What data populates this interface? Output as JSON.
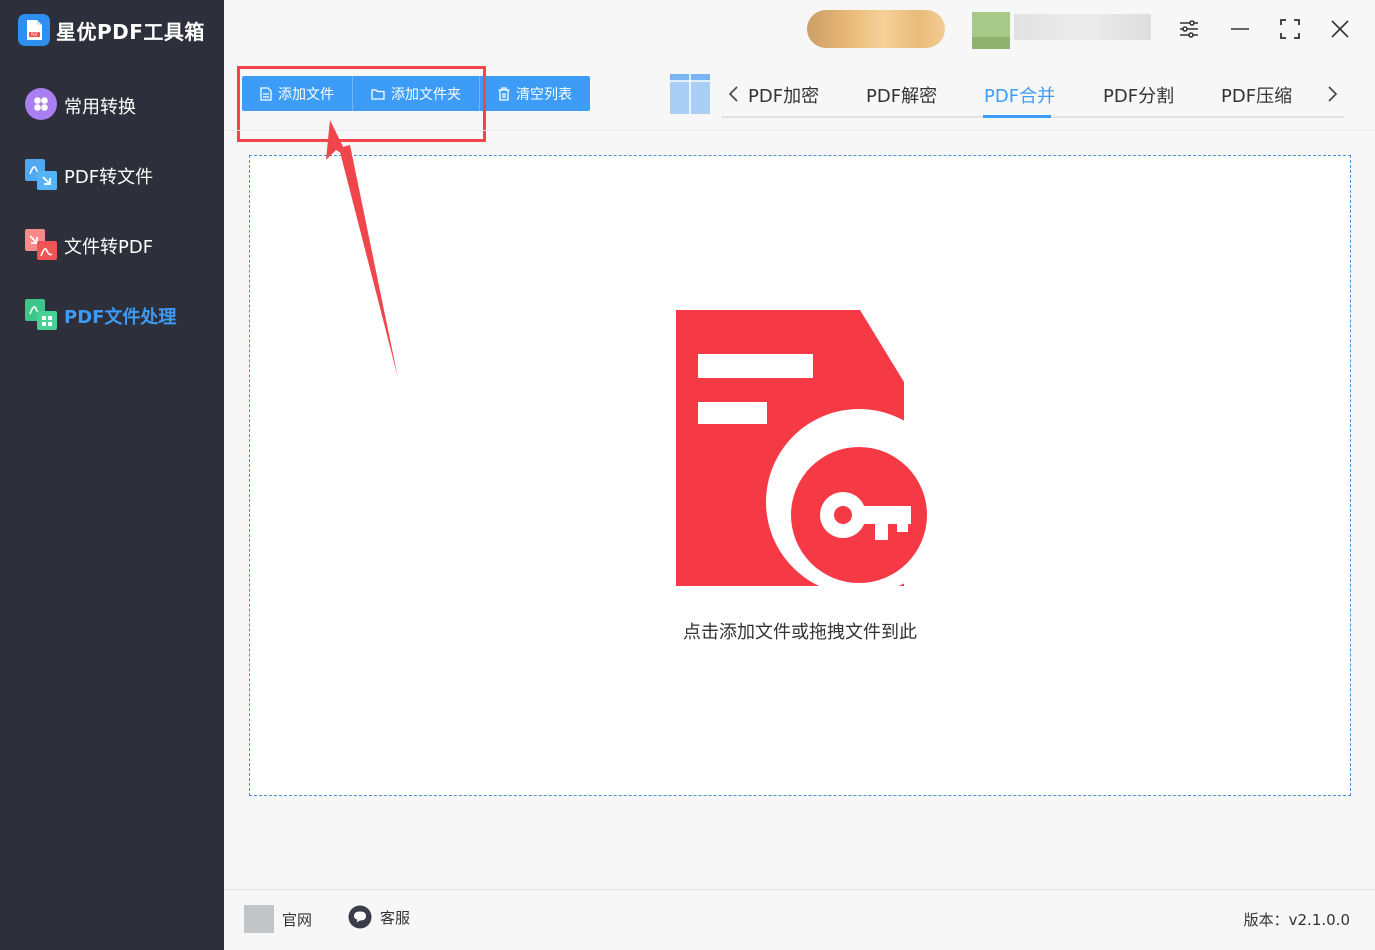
{
  "app": {
    "title": "星优PDF工具箱",
    "logo_icon": "pdf-logo-icon"
  },
  "sidebar": {
    "items": [
      {
        "label": "常用转换",
        "icon": "grid-flower-icon",
        "active": false
      },
      {
        "label": "PDF转文件",
        "icon": "pdf-to-file-icon",
        "active": false
      },
      {
        "label": "文件转PDF",
        "icon": "file-to-pdf-icon",
        "active": false
      },
      {
        "label": "PDF文件处理",
        "icon": "pdf-process-icon",
        "active": true
      }
    ]
  },
  "toolbar": {
    "add_file": "添加文件",
    "add_folder": "添加文件夹",
    "clear_list": "清空列表"
  },
  "tabs": {
    "items": [
      "PDF加密",
      "PDF解密",
      "PDF合并",
      "PDF分割",
      "PDF压缩"
    ],
    "active": "PDF合并"
  },
  "dropzone": {
    "hint": "点击添加文件或拖拽文件到此"
  },
  "footer": {
    "website": "官网",
    "support": "客服",
    "version": "版本：v2.1.0.0"
  },
  "colors": {
    "sidebar_bg": "#2d2f3b",
    "accent": "#3c9cf7",
    "highlight": "#f0454b",
    "pdf_red": "#f53a46"
  }
}
